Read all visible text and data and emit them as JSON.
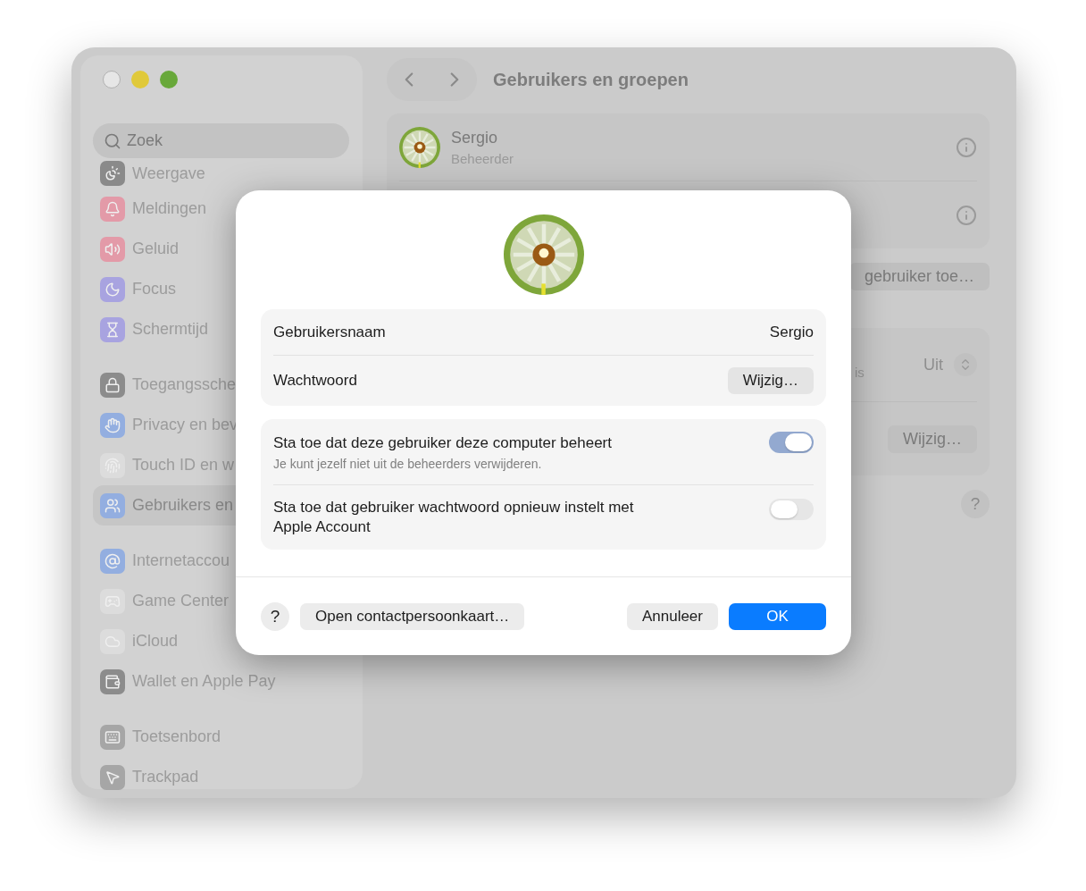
{
  "window": {
    "title": "Gebruikers en groepen"
  },
  "sidebar": {
    "search": {
      "placeholder": "Zoek"
    },
    "groups": [
      [
        {
          "label": "Weergave",
          "selected": false,
          "color": "#8a8a8a"
        }
      ],
      [
        {
          "label": "Meldingen",
          "selected": false,
          "color": "#e39aa8"
        },
        {
          "label": "Geluid",
          "selected": false,
          "color": "#e39aa8"
        },
        {
          "label": "Focus",
          "selected": false,
          "color": "#a8a3e0"
        },
        {
          "label": "Schermtijd",
          "selected": false,
          "color": "#a8a3e0"
        }
      ],
      [
        {
          "label": "Toegangssche",
          "selected": false,
          "color": "#8c8c8c"
        },
        {
          "label": "Privacy en bev",
          "selected": false,
          "color": "#93aee0"
        },
        {
          "label": "Touch ID en w",
          "selected": false,
          "color": "#dcdcdc"
        },
        {
          "label": "Gebruikers en",
          "selected": true,
          "color": "#93aee0"
        }
      ],
      [
        {
          "label": "Internetaccou",
          "selected": false,
          "color": "#93aee0"
        },
        {
          "label": "Game Center",
          "selected": false,
          "color": "#dcdcdc"
        },
        {
          "label": "iCloud",
          "selected": false,
          "color": "#dcdcdc"
        },
        {
          "label": "Wallet en Apple Pay",
          "selected": false,
          "color": "#8c8c8c"
        }
      ],
      [
        {
          "label": "Toetsenbord",
          "selected": false,
          "color": "#a6a6a6"
        },
        {
          "label": "Trackpad",
          "selected": false,
          "color": "#a6a6a6"
        }
      ]
    ]
  },
  "users": [
    {
      "kind": "user",
      "name": "Sergio",
      "role": "Beheerder"
    },
    {
      "kind": "covered"
    }
  ],
  "add_button": {
    "label": "gebruiker toe…"
  },
  "settings": [
    {
      "kind": "select",
      "label": "is",
      "value": "Uit"
    },
    {
      "kind": "button",
      "button": "Wijzig…"
    }
  ],
  "help": "?",
  "dialog": {
    "fields": [
      {
        "kind": "text",
        "label": "Gebruikersnaam",
        "value": "Sergio"
      },
      {
        "kind": "button",
        "label": "Wachtwoord",
        "button": "Wijzig…"
      }
    ],
    "toggles": [
      {
        "label": "Sta toe dat deze gebruiker deze computer beheert",
        "note": "Je kunt jezelf niet uit de beheerders verwijderen.",
        "on": true
      },
      {
        "label": "Sta toe dat gebruiker wachtwoord opnieuw instelt met Apple Account",
        "on": false
      }
    ],
    "help": "?",
    "contact_button": "Open contactpersoonkaart…",
    "cancel_button": "Annuleer",
    "ok_button": "OK"
  }
}
